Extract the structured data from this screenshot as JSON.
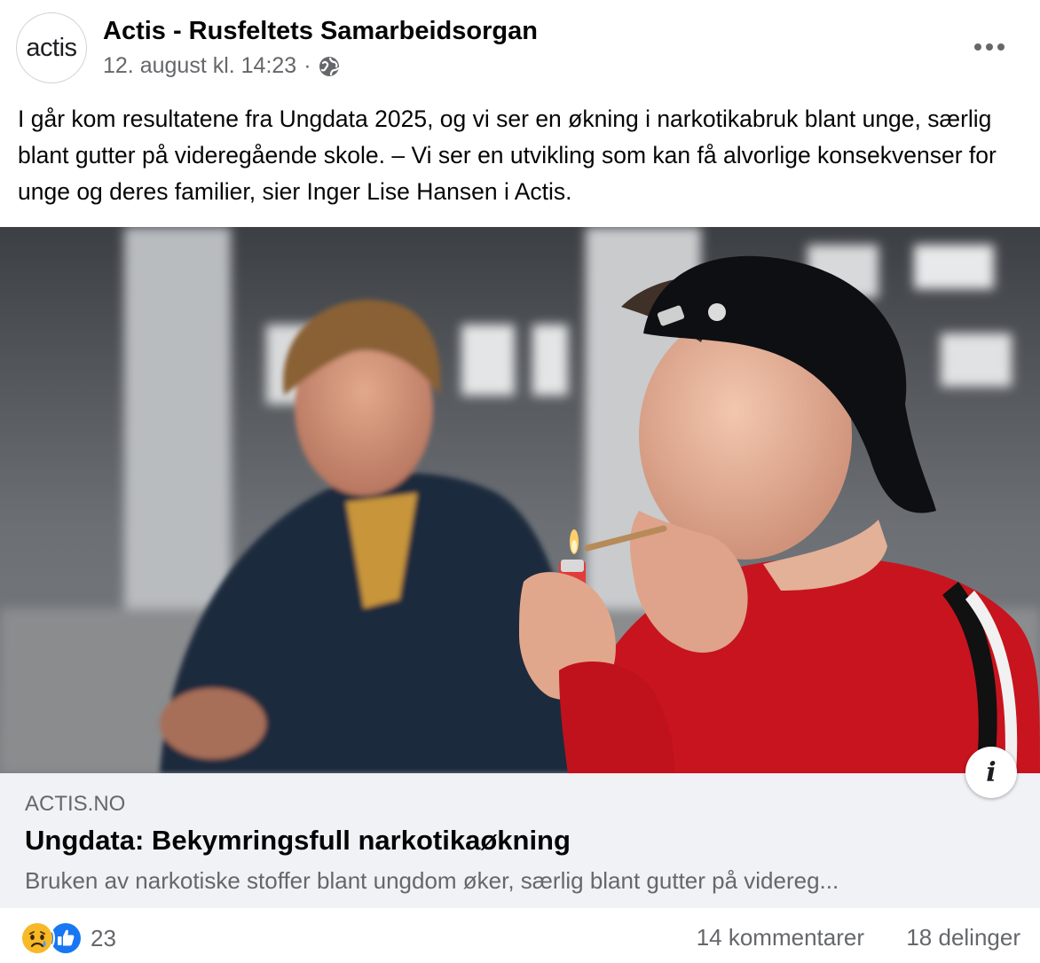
{
  "post": {
    "page_name": "Actis - Rusfeltets Samarbeidsorgan",
    "avatar_text": "actis",
    "date": "12. august kl. 14:23",
    "separator": "·",
    "audience_icon": "globe-icon",
    "more_icon": "more-options-icon",
    "text": "I går kom resultatene fra Ungdata 2025, og vi ser en økning i narkotikabruk blant unge, særlig blant gutter på videregående skole. – Vi ser en utvikling som kan få alvorlige konsekvenser for unge og deres familier, sier Inger Lise Hansen i Actis."
  },
  "link_preview": {
    "info_icon": "i",
    "domain": "ACTIS.NO",
    "title": "Ungdata: Bekymringsfull narkotikaøkning",
    "description": "Bruken av narkotiske stoffer blant ungdom øker, særlig blant gutter på videreg..."
  },
  "engagement": {
    "reaction_icons": [
      "sad-reaction-icon",
      "like-reaction-icon"
    ],
    "reaction_count": "23",
    "comments": "14 kommentarer",
    "shares": "18 delinger"
  },
  "colors": {
    "text_primary": "#050505",
    "text_secondary": "#65676b",
    "card_background": "#f0f2f5",
    "like_blue": "#1877f2",
    "sad_yellow": "#f7b928"
  }
}
